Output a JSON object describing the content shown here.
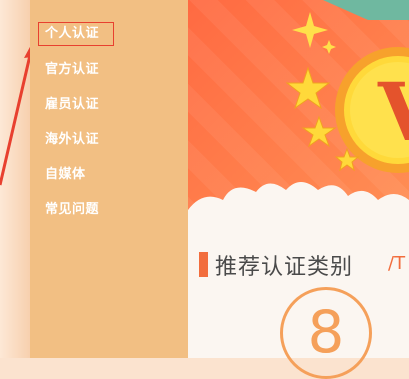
{
  "sidebar": {
    "items": [
      {
        "label": "个人认证",
        "active": true
      },
      {
        "label": "官方认证"
      },
      {
        "label": "雇员认证"
      },
      {
        "label": "海外认证"
      },
      {
        "label": "自媒体"
      },
      {
        "label": "常见问题"
      }
    ]
  },
  "section": {
    "title": "推荐认证类别",
    "suffix": "/T"
  },
  "badge": {
    "number": "8",
    "emblem_letter": "V"
  },
  "icons": [
    "star-icon",
    "sparkle-icon",
    "v-badge-icon",
    "arrow-pointer-icon"
  ],
  "colors": {
    "sidebar": "#f2bf83",
    "banner": "#ff7b4a",
    "accent": "#f26d3d",
    "highlight_border": "#e8402f",
    "badge": "#f5a05a"
  }
}
